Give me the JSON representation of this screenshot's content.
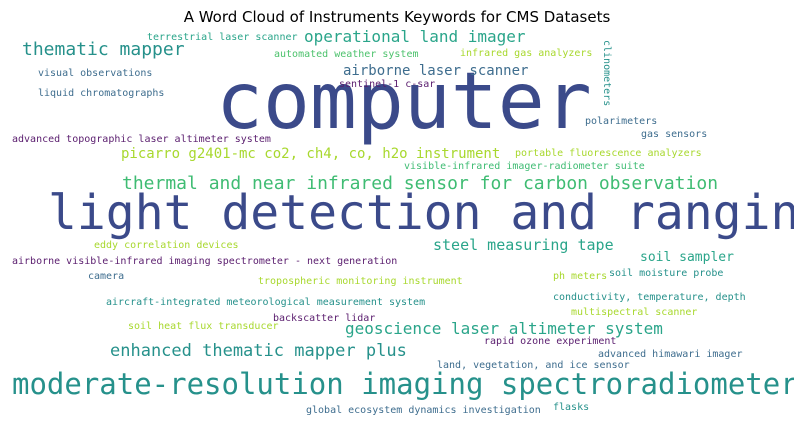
{
  "chart_data": {
    "type": "wordcloud",
    "title": "A Word Cloud of Instruments Keywords for CMS Datasets",
    "colors": {
      "darkblue": "#3b4a8a",
      "teal": "#26918b",
      "green": "#3fbc73",
      "lime": "#a8d82e",
      "purple": "#5a1d6e",
      "slate": "#3e6d8e",
      "aqua": "#2aa58a",
      "sea": "#4cc26c"
    },
    "words": [
      {
        "text": "computer",
        "weight": 100,
        "color": "darkblue"
      },
      {
        "text": "light detection and ranging",
        "weight": 64,
        "color": "darkblue"
      },
      {
        "text": "moderate-resolution imaging spectroradiometer",
        "weight": 40,
        "color": "teal"
      },
      {
        "text": "thermal and near infrared sensor for carbon observation",
        "weight": 26,
        "color": "green"
      },
      {
        "text": "enhanced thematic mapper plus",
        "weight": 24,
        "color": "teal"
      },
      {
        "text": "geoscience laser altimeter system",
        "weight": 22,
        "color": "aqua"
      },
      {
        "text": "thematic mapper",
        "weight": 22,
        "color": "teal"
      },
      {
        "text": "operational land imager",
        "weight": 21,
        "color": "aqua"
      },
      {
        "text": "steel measuring tape",
        "weight": 20,
        "color": "aqua"
      },
      {
        "text": "airborne laser scanner",
        "weight": 17,
        "color": "slate"
      },
      {
        "text": "picarro g2401-mc co2, ch4, co, h2o instrument",
        "weight": 17,
        "color": "lime"
      },
      {
        "text": "soil sampler",
        "weight": 16,
        "color": "aqua"
      },
      {
        "text": "terrestrial laser scanner",
        "weight": 12,
        "color": "aqua"
      },
      {
        "text": "automated weather system",
        "weight": 12,
        "color": "sea"
      },
      {
        "text": "infrared gas analyzers",
        "weight": 12,
        "color": "lime"
      },
      {
        "text": "clinometers",
        "weight": 11,
        "color": "teal"
      },
      {
        "text": "visual observations",
        "weight": 12,
        "color": "slate"
      },
      {
        "text": "liquid chromatographs",
        "weight": 12,
        "color": "slate"
      },
      {
        "text": "sentinel-1 c-sar",
        "weight": 12,
        "color": "purple"
      },
      {
        "text": "polarimeters",
        "weight": 11,
        "color": "slate"
      },
      {
        "text": "gas sensors",
        "weight": 11,
        "color": "slate"
      },
      {
        "text": "advanced topographic laser altimeter system",
        "weight": 12,
        "color": "purple"
      },
      {
        "text": "portable fluorescence analyzers",
        "weight": 12,
        "color": "lime"
      },
      {
        "text": "visible-infrared imager-radiometer suite",
        "weight": 12,
        "color": "green"
      },
      {
        "text": "eddy correlation devices",
        "weight": 12,
        "color": "lime"
      },
      {
        "text": "airborne visible-infrared imaging spectrometer - next generation",
        "weight": 12,
        "color": "purple"
      },
      {
        "text": "camera",
        "weight": 11,
        "color": "slate"
      },
      {
        "text": "tropospheric monitoring instrument",
        "weight": 12,
        "color": "lime"
      },
      {
        "text": "ph meters",
        "weight": 11,
        "color": "lime"
      },
      {
        "text": "soil moisture probe",
        "weight": 11,
        "color": "teal"
      },
      {
        "text": "aircraft-integrated meteorological measurement system",
        "weight": 12,
        "color": "teal"
      },
      {
        "text": "conductivity, temperature, depth",
        "weight": 12,
        "color": "teal"
      },
      {
        "text": "backscatter lidar",
        "weight": 12,
        "color": "purple"
      },
      {
        "text": "multispectral scanner",
        "weight": 12,
        "color": "lime"
      },
      {
        "text": "soil heat flux transducer",
        "weight": 12,
        "color": "lime"
      },
      {
        "text": "rapid ozone experiment",
        "weight": 12,
        "color": "purple"
      },
      {
        "text": "advanced himawari imager",
        "weight": 12,
        "color": "slate"
      },
      {
        "text": "land, vegetation, and ice sensor",
        "weight": 12,
        "color": "slate"
      },
      {
        "text": "global ecosystem dynamics investigation",
        "weight": 12,
        "color": "slate"
      },
      {
        "text": "flasks",
        "weight": 11,
        "color": "teal"
      }
    ]
  }
}
